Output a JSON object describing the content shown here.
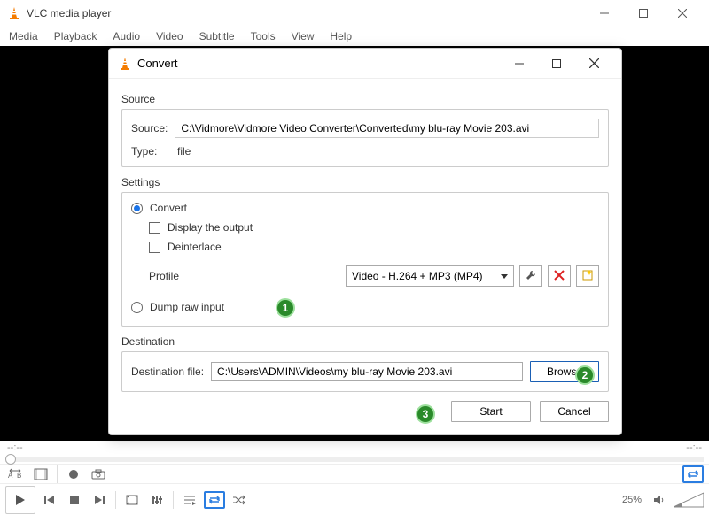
{
  "main_window": {
    "title": "VLC media player",
    "menu": [
      "Media",
      "Playback",
      "Audio",
      "Video",
      "Subtitle",
      "Tools",
      "View",
      "Help"
    ],
    "time_left": "--:--",
    "time_right": "--:--",
    "volume_label": "25%"
  },
  "dialog": {
    "title": "Convert",
    "source_group": "Source",
    "source_label": "Source:",
    "source_value": "C:\\Vidmore\\Vidmore Video Converter\\Converted\\my blu-ray Movie 203.avi",
    "type_label": "Type:",
    "type_value": "file",
    "settings_group": "Settings",
    "convert_option": "Convert",
    "display_output": "Display the output",
    "deinterlace": "Deinterlace",
    "profile_label": "Profile",
    "profile_value": "Video - H.264 + MP3 (MP4)",
    "dump_option": "Dump raw input",
    "dest_group": "Destination",
    "dest_label": "Destination file:",
    "dest_value": "C:\\Users\\ADMIN\\Videos\\my blu-ray Movie 203.avi",
    "browse": "Browse",
    "start": "Start",
    "cancel": "Cancel"
  },
  "badges": {
    "one": "1",
    "two": "2",
    "three": "3"
  }
}
